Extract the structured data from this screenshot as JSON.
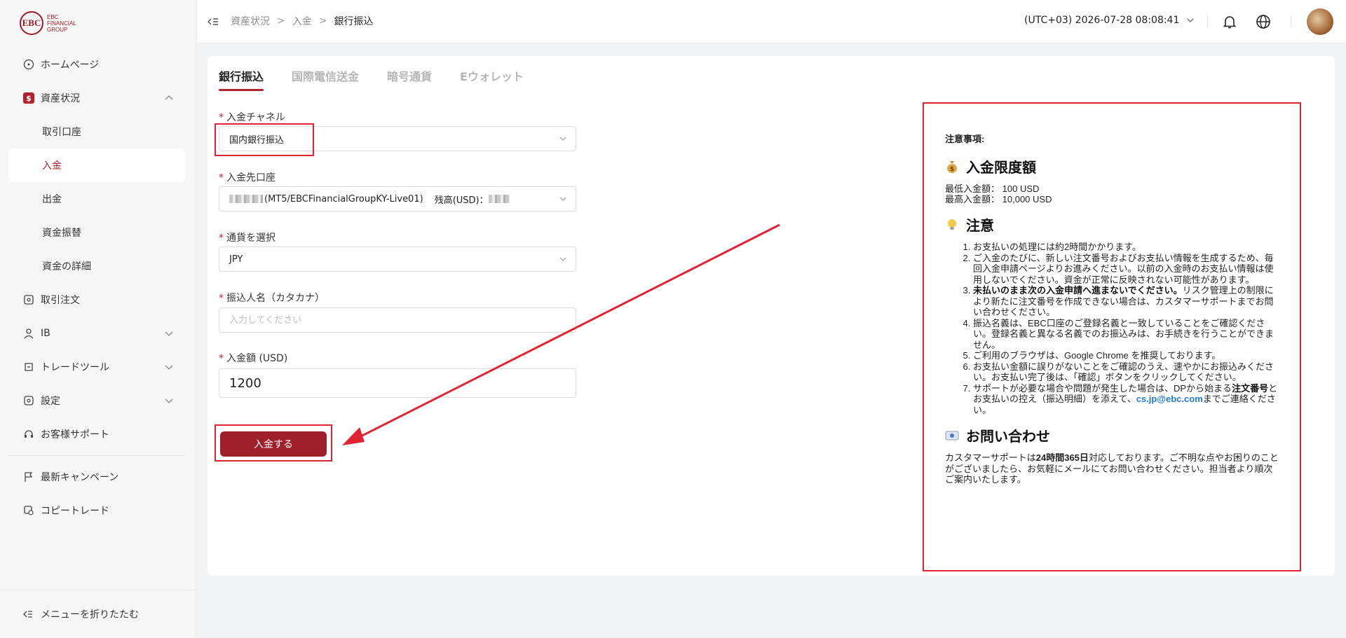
{
  "sidebar": {
    "logo_mark": "EBC",
    "logo_text": [
      "EBC",
      "FINANCIAL",
      "GROUP"
    ],
    "items": [
      {
        "label": "ホームページ"
      },
      {
        "label": "資産状況"
      },
      {
        "label": "取引口座"
      },
      {
        "label": "入金"
      },
      {
        "label": "出金"
      },
      {
        "label": "資金振替"
      },
      {
        "label": "資金の詳細"
      },
      {
        "label": "取引注文"
      },
      {
        "label": "IB"
      },
      {
        "label": "トレードツール"
      },
      {
        "label": "設定"
      },
      {
        "label": "お客様サポート"
      },
      {
        "label": "最新キャンペーン"
      },
      {
        "label": "コピートレード"
      }
    ],
    "collapse_label": "メニューを折りたたむ"
  },
  "header": {
    "breadcrumb": [
      "資産状況",
      "入金",
      "銀行振込"
    ],
    "timezone": "(UTC+03)",
    "datetime": "2026-07-28 08:08:41"
  },
  "tabs": [
    "銀行振込",
    "国際電信送金",
    "暗号通貨",
    "Eウォレット"
  ],
  "form": {
    "channel_label": "入金チャネル",
    "channel_value": "国内銀行振込",
    "account_label": "入金先口座",
    "account_value": "(MT5/EBCFinancialGroupKY-Live01)",
    "balance_label": "残高(USD)：",
    "currency_label": "通貨を選択",
    "currency_value": "JPY",
    "name_label": "振込人名（カタカナ）",
    "name_placeholder": "入力してください",
    "amount_label": "入金額 (USD)",
    "amount_value": "1200",
    "submit_label": "入金する"
  },
  "notice": {
    "title": "注意事項:",
    "limit_heading": "入金限度額",
    "min_label": "最低入金額：",
    "min_value": "100 USD",
    "max_label": "最高入金額：",
    "max_value": "10,000 USD",
    "caution_heading": "注意",
    "notes": {
      "n1": "お支払いの処理には約2時間かかります。",
      "n2": "ご入金のたびに、新しい注文番号およびお支払い情報を生成するため、毎回入金申請ページよりお進みください。以前の入金時のお支払い情報は使用しないでください。資金が正常に反映されない可能性があります。",
      "n3_bold": "未払いのまま次の入金申請へ進まないでください。",
      "n3_rest": "リスク管理上の制限により新たに注文番号を作成できない場合は、カスタマーサポートまでお問い合わせください。",
      "n4": "振込名義は、EBC口座のご登録名義と一致していることをご確認ください。登録名義と異なる名義でのお振込みは、お手続きを行うことができません。",
      "n5": "ご利用のブラウザは、Google Chrome を推奨しております。",
      "n6": "お支払い金額に誤りがないことをご確認のうえ、速やかにお振込みください。お支払い完了後は、「確認」ボタンをクリックしてください。",
      "n7_a": "サポートが必要な場合や問題が発生した場合は、DPから始まる",
      "n7_bold": "注文番号",
      "n7_b": "とお支払いの控え（振込明細）を添えて、",
      "n7_email": "cs.jp@ebc.com",
      "n7_c": "までご連絡ください。"
    },
    "contact_heading": "お問い合わせ",
    "contact_a": "カスタマーサポートは",
    "contact_bold": "24時間365日",
    "contact_b": "対応しております。ご不明な点やお困りのことがございましたら、お気軽にメールにてお問い合わせください。担当者より順次ご案内いたします。"
  },
  "colors": {
    "brand": "#9f1f2b",
    "highlight": "#e02433",
    "link": "#1f7ad6"
  }
}
